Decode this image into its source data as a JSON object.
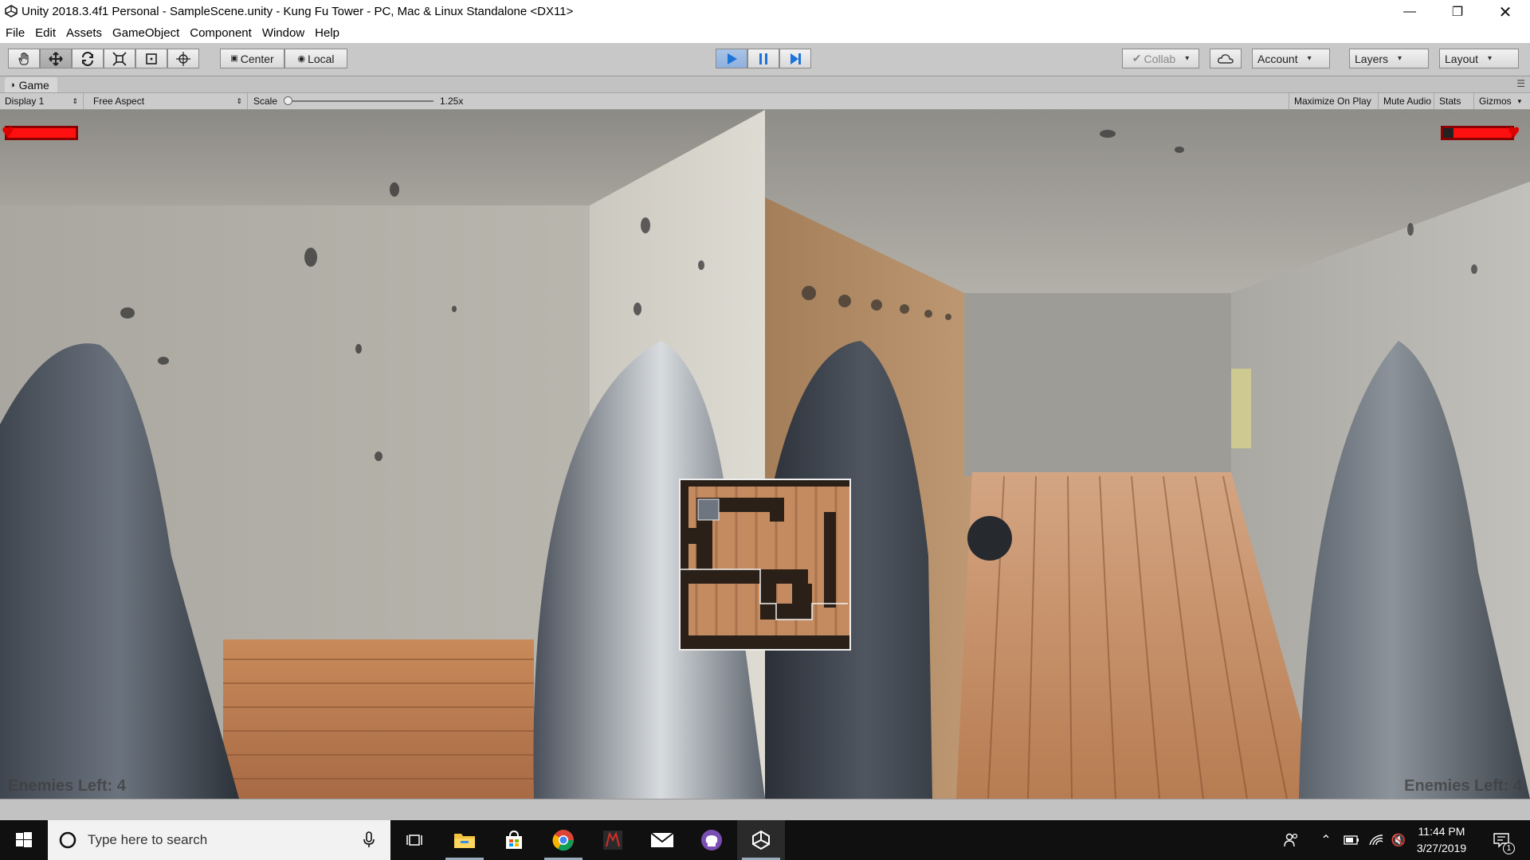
{
  "window": {
    "title": "Unity 2018.3.4f1 Personal - SampleScene.unity - Kung Fu Tower - PC, Mac & Linux Standalone <DX11>",
    "controls": [
      "minimize-icon",
      "restore-icon",
      "close-icon"
    ]
  },
  "menu": [
    "File",
    "Edit",
    "Assets",
    "GameObject",
    "Component",
    "Window",
    "Help"
  ],
  "toolbar": {
    "tools": [
      "hand-tool-icon",
      "move-tool-icon",
      "rotate-tool-icon",
      "scale-tool-icon",
      "rect-tool-icon",
      "transform-tool-icon"
    ],
    "active_tool": "move-tool-icon",
    "pivot_label": "Center",
    "space_label": "Local",
    "collab_label": "Collab",
    "account_label": "Account",
    "layers_label": "Layers",
    "layout_label": "Layout",
    "play_state": "playing"
  },
  "game_panel": {
    "tab_label": "Game",
    "display": "Display 1",
    "aspect": "Free Aspect",
    "scale_label": "Scale",
    "scale_value": "1.25x",
    "maximize_on_play": "Maximize On Play",
    "mute_audio": "Mute Audio",
    "stats": "Stats",
    "gizmos": "Gizmos"
  },
  "hud": {
    "left": {
      "enemies_text": "Enemies Left: 4",
      "health": 1.0
    },
    "right": {
      "enemies_text": "Enemies Left: 4",
      "health": 0.85
    }
  },
  "colors": {
    "health_red": "#ff1010",
    "play_blue": "#1e73d9",
    "toolbar_bg": "#c8c8c8"
  },
  "taskbar": {
    "search_placeholder": "Type here to search",
    "apps": [
      "task-view-icon",
      "file-explorer-icon",
      "store-icon",
      "chrome-icon",
      "razer-icon",
      "mail-icon",
      "github-icon",
      "unity-icon"
    ],
    "time": "11:44 PM",
    "date": "3/27/2019",
    "notification_count": "1"
  }
}
